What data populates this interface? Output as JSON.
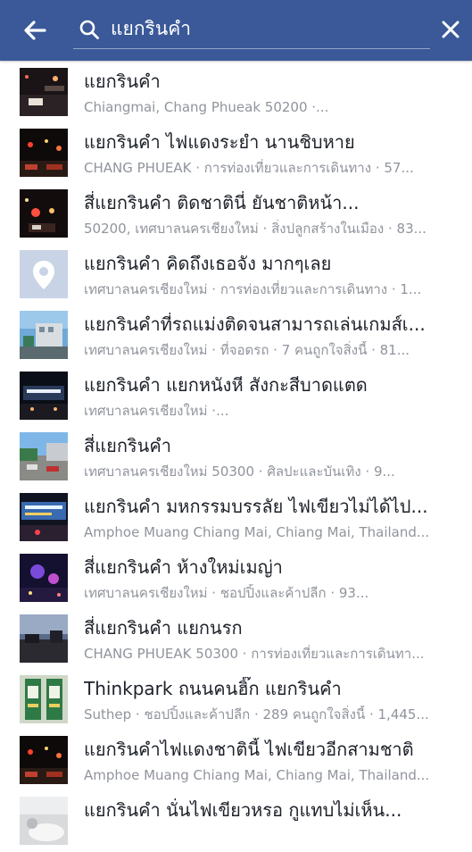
{
  "colors": {
    "header_bg": "#3b5998",
    "title_text": "#1d2129",
    "subtitle_text": "#90949c",
    "placeholder_thumb": "#c9d3e6"
  },
  "header": {
    "back_icon": "arrow-left-icon",
    "search_icon": "search-icon",
    "search_value": "แยกรินคำ",
    "clear_icon": "close-icon"
  },
  "results": [
    {
      "title": "แยกรินคำ",
      "subtitle": "Chiangmai, Chang Phueak 50200 ·...",
      "thumb": "night-street"
    },
    {
      "title": "แยกรินคำ ไฟแดงระยำ นานชิบหาย",
      "subtitle": "CHANG PHUEAK · การท่องเที่ยวและการเดินทาง · 57...",
      "thumb": "night-traffic"
    },
    {
      "title": "สี่แยกรินคำ ติดชาตินี่ ยันชาติหน้า...",
      "subtitle": "50200, เทศบาลนครเชียงใหม่ · สิ่งปลูกสร้างในเมือง · 83...",
      "thumb": "night-lights"
    },
    {
      "title": "แยกรินคำ คิดถึงเธอจัง มากๆเลย",
      "subtitle": "เทศบาลนครเชียงใหม่ · การท่องเที่ยวและการเดินทาง · 1...",
      "thumb": "location-placeholder"
    },
    {
      "title": "แยกรินคำที่รถแม่งติดจนสามารถเล่นเกมส์เ...",
      "subtitle": "เทศบาลนครเชียงใหม่ · ที่จอดรถ · 7 คนถูกใจสิ่งนี้ · 81...",
      "thumb": "day-building"
    },
    {
      "title": "แยกรินคำ แยกหนังหี สังกะสีบาดแตด",
      "subtitle": "เทศบาลนครเชียงใหม่ ·...",
      "thumb": "night-mall"
    },
    {
      "title": "สี่แยกรินคำ",
      "subtitle": "เทศบาลนครเชียงใหม่ 50300 · ศิลปะและบันเทิง · 9...",
      "thumb": "day-intersection"
    },
    {
      "title": "แยกรินคำ มหกรรมบรรลัย ไฟเขียวไม่ได้ไป...",
      "subtitle": "Amphoe Muang Chiang Mai, Chiang Mai, Thailand...",
      "thumb": "night-sign"
    },
    {
      "title": "สี่แยกรินคำ ห้างใหม่เมญ่า",
      "subtitle": "เทศบาลนครเชียงใหม่ · ชอปปิ้งและค้าปลีก · 93...",
      "thumb": "night-purple"
    },
    {
      "title": "สี่แยกรินคำ แยกนรก",
      "subtitle": "CHANG PHUEAK 50300 · การท่องเที่ยวและการเดินทา...",
      "thumb": "dusk-road"
    },
    {
      "title": "Thinkpark ถนนคนฮิ๊ก แยกรินคำ",
      "subtitle": "Suthep · ชอปปิ้งและค้าปลีก · 289 คนถูกใจสิ่งนี้ · 1,445...",
      "thumb": "banners"
    },
    {
      "title": "แยกรินคำไฟแดงชาตินี้ ไฟเขียวอีกสามชาติ",
      "subtitle": "Amphoe Muang Chiang Mai, Chiang Mai, Thailand...",
      "thumb": "night-traffic"
    },
    {
      "title": "แยกรินคำ นั่นไฟเขียวหรอ กูแทบไม่เห็น...",
      "subtitle": "",
      "thumb": "snow-white"
    }
  ]
}
